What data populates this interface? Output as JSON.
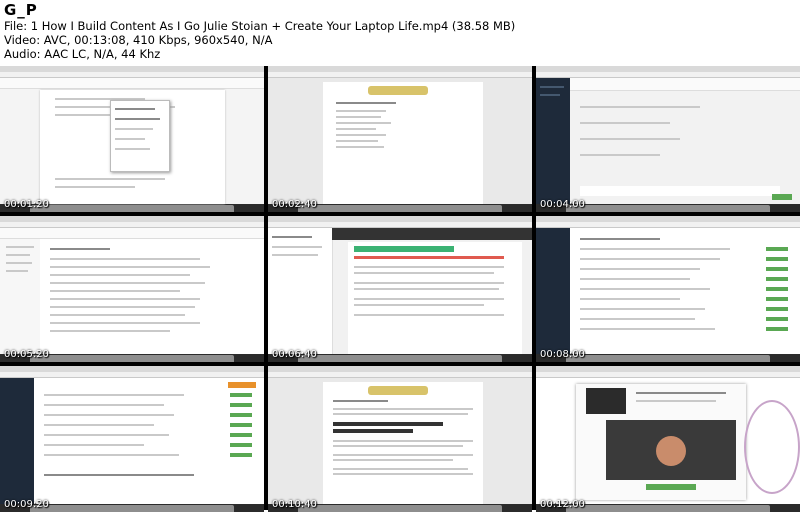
{
  "header": {
    "logo": "G_P",
    "file_line": "File: 1 How I Build Content As I Go   Julie Stoian + Create Your Laptop Life.mp4 (38.58 MB)",
    "video_line": "Video: AVC, 00:13:08, 410 Kbps, 960x540, N/A",
    "audio_line": "Audio: AAC LC, N/A, 44 Khz"
  },
  "thumbnails": [
    {
      "timestamp": "00:01:20",
      "screen": "google-docs"
    },
    {
      "timestamp": "00:02:40",
      "screen": "sales-funnel-doc"
    },
    {
      "timestamp": "00:04:00",
      "screen": "membership-admin"
    },
    {
      "timestamp": "00:05:20",
      "screen": "google-drive"
    },
    {
      "timestamp": "00:06:40",
      "screen": "membership-platform-resources"
    },
    {
      "timestamp": "00:08:00",
      "screen": "course-modules-list"
    },
    {
      "timestamp": "00:09:20",
      "screen": "course-modules-list-2"
    },
    {
      "timestamp": "00:10:40",
      "screen": "sales-copy-doc"
    },
    {
      "timestamp": "00:12:00",
      "screen": "affiliate-offer-webinar"
    }
  ]
}
